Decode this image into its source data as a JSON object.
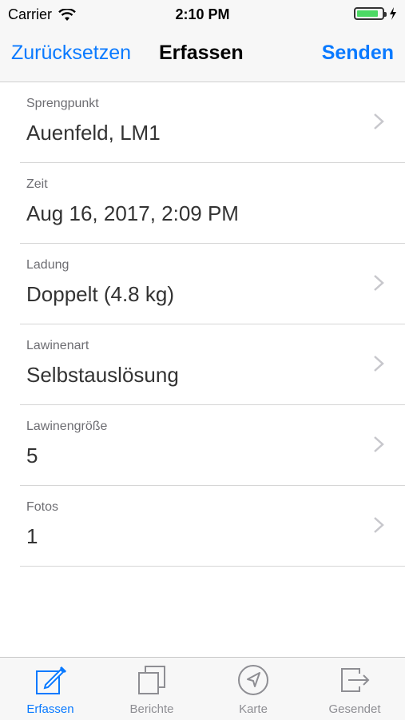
{
  "status_bar": {
    "carrier": "Carrier",
    "time": "2:10 PM",
    "battery_level": 0.85,
    "battery_color": "#4cd964"
  },
  "nav": {
    "left_label": "Zurücksetzen",
    "title": "Erfassen",
    "right_label": "Senden",
    "accent_color": "#0a7aff"
  },
  "rows": [
    {
      "label": "Sprengpunkt",
      "value": "Auenfeld, LM1",
      "has_chevron": true
    },
    {
      "label": "Zeit",
      "value": "Aug 16, 2017, 2:09 PM",
      "has_chevron": false
    },
    {
      "label": "Ladung",
      "value": "Doppelt (4.8 kg)",
      "has_chevron": true
    },
    {
      "label": "Lawinenart",
      "value": "Selbstauslösung",
      "has_chevron": true
    },
    {
      "label": "Lawinengröße",
      "value": "5",
      "has_chevron": true
    },
    {
      "label": "Fotos",
      "value": "1",
      "has_chevron": true
    }
  ],
  "tabs": [
    {
      "label": "Erfassen",
      "icon": "compose-icon",
      "active": true
    },
    {
      "label": "Berichte",
      "icon": "stacked-pages-icon",
      "active": false
    },
    {
      "label": "Karte",
      "icon": "location-arrow-icon",
      "active": false
    },
    {
      "label": "Gesendet",
      "icon": "export-icon",
      "active": false
    }
  ]
}
